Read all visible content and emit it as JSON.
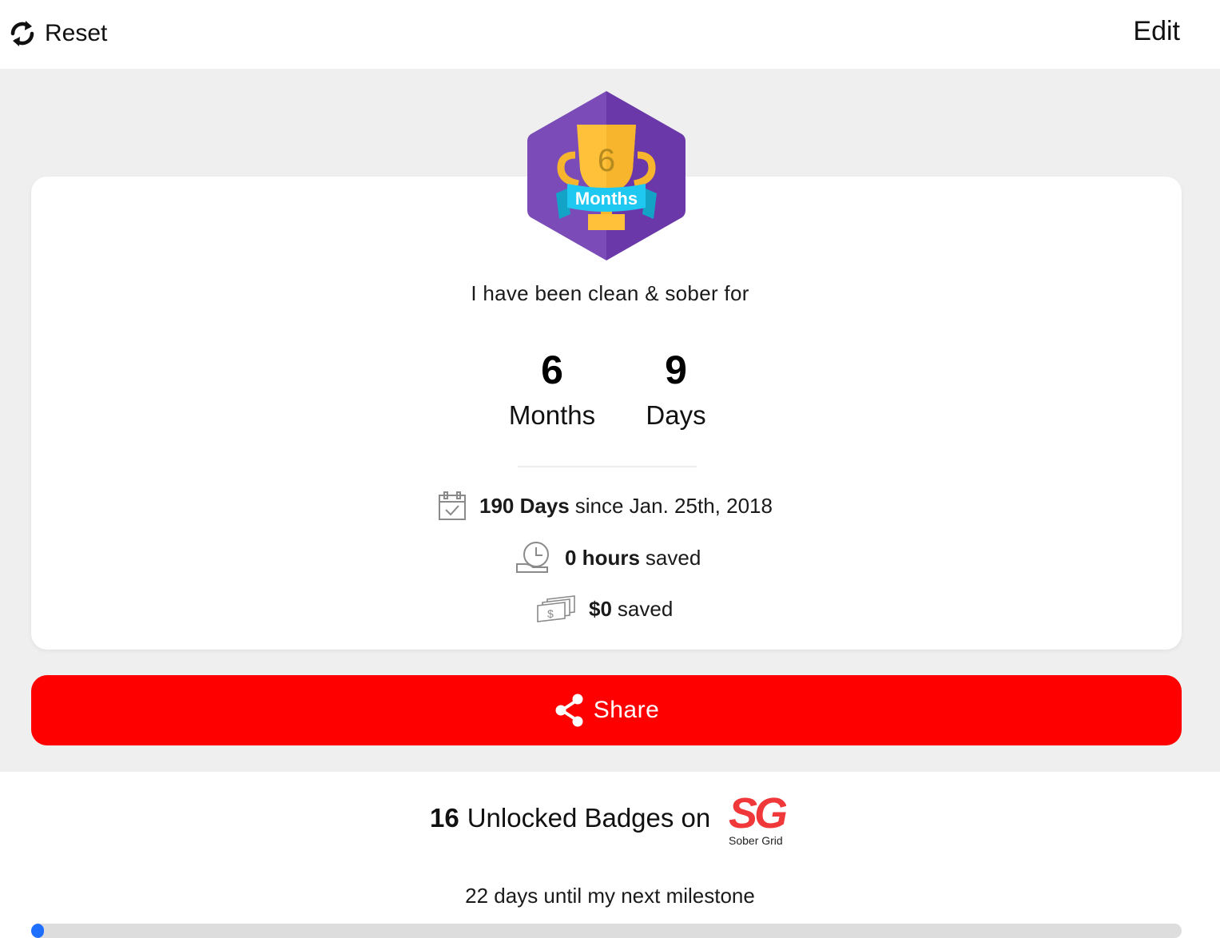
{
  "topbar": {
    "reset_label": "Reset",
    "edit_label": "Edit"
  },
  "badge": {
    "number": "6",
    "ribbon_text": "Months",
    "colors": {
      "hex_left": "#7b4cb8",
      "hex_right": "#6a38a8",
      "trophy": "#ffc03a",
      "ribbon": "#1ec8f0"
    }
  },
  "card": {
    "lead_text": "I have been clean & sober for",
    "counters": [
      {
        "value": "6",
        "unit": "Months"
      },
      {
        "value": "9",
        "unit": "Days"
      }
    ],
    "stats": {
      "days_bold": "190 Days",
      "days_rest": "since Jan. 25th, 2018",
      "hours_bold": "0 hours",
      "hours_rest": "saved",
      "money_bold": "$0",
      "money_rest": "saved"
    }
  },
  "share": {
    "label": "Share",
    "color": "#ff0000"
  },
  "badges": {
    "count": "16",
    "text": "Unlocked Badges on",
    "logo_text": "Sober Grid",
    "logo_mark": "SG"
  },
  "milestone": {
    "text": "22 days until my next milestone",
    "progress_fraction": 0.0
  }
}
